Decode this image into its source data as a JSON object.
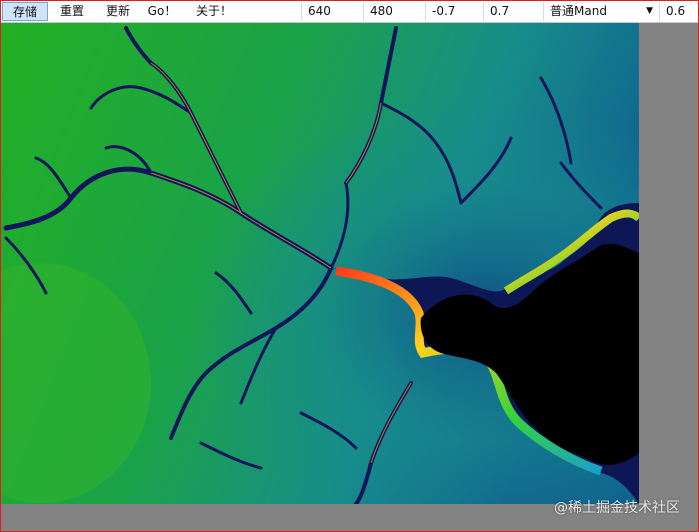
{
  "toolbar": {
    "save_label": "存储",
    "reset_label": "重置",
    "update_label": "更新",
    "go_label": "Go！",
    "about_label": "关于！",
    "width_value": "640",
    "height_value": "480",
    "x_value": "-0.7",
    "y_value": "0.7",
    "mode_value": "普通Mand",
    "extra_value": "0.6"
  },
  "watermark": "@稀土掘金技术社区",
  "colors": {
    "accent_border": "#e21b1b",
    "background_gray": "#838383",
    "fractal_green": "#1aa01a",
    "fractal_teal": "#1a8a8a",
    "fractal_navy": "#121458",
    "fractal_black": "#000000"
  },
  "icons": {
    "dropdown": "chevron-down-icon"
  }
}
